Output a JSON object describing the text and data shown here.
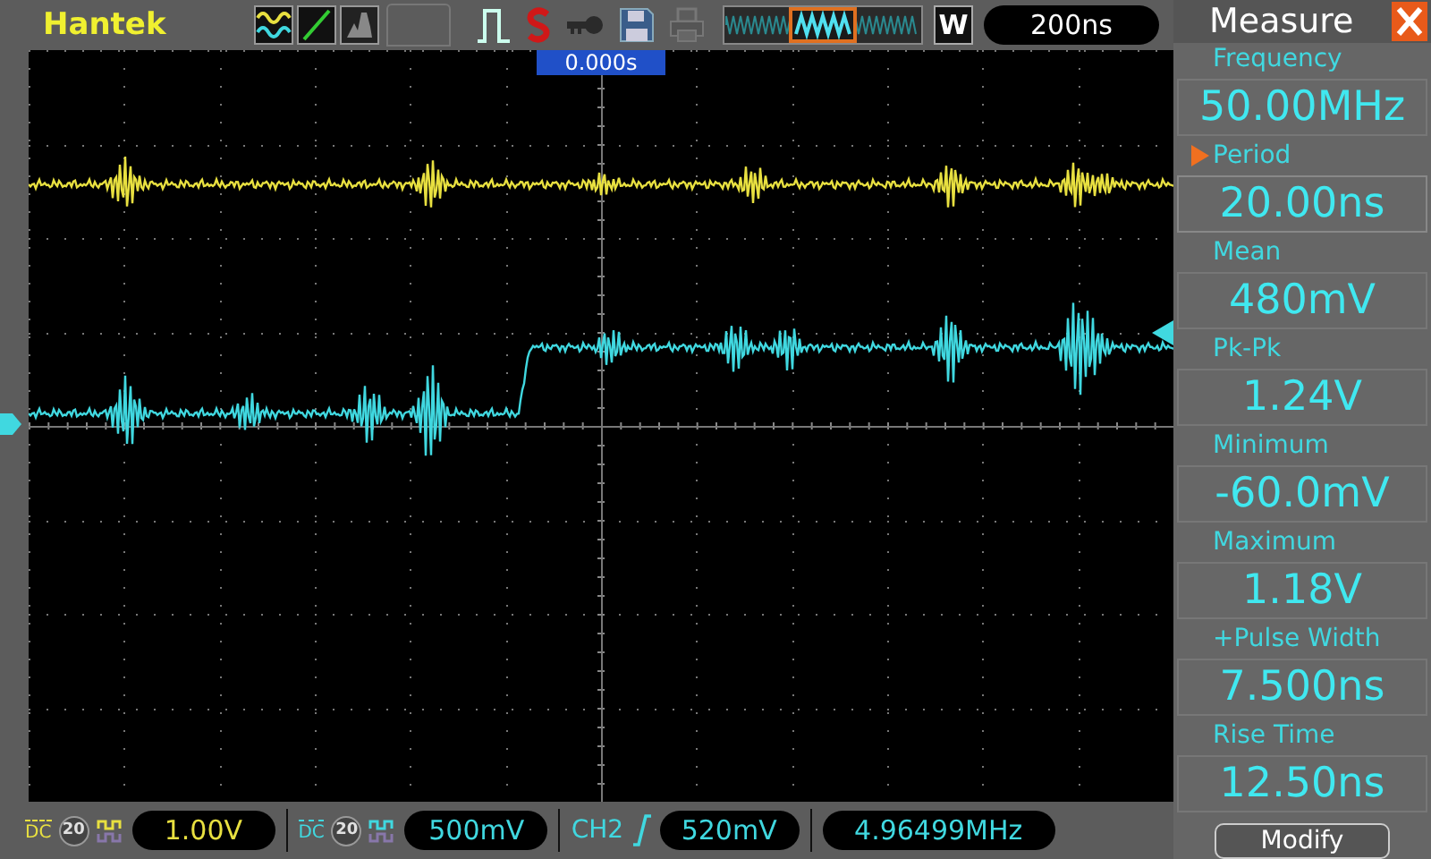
{
  "brand": "Hantek",
  "toolbar": {
    "window_label": "W",
    "timebase": "200ns"
  },
  "trigger_marker": "0.000s",
  "channels": [
    {
      "coupling": "DC",
      "bandwidth_limit": "20",
      "scale": "1.00V",
      "color": "#e8e040"
    },
    {
      "coupling": "DC",
      "bandwidth_limit": "20",
      "scale": "500mV",
      "color": "#40d8e0"
    }
  ],
  "trigger": {
    "source": "CH2",
    "level": "520mV",
    "frequency": "4.96499MHz"
  },
  "measure": {
    "title": "Measure",
    "items": [
      {
        "label": "Frequency",
        "value": "50.00MHz",
        "selected": false
      },
      {
        "label": "Period",
        "value": "20.00ns",
        "selected": true
      },
      {
        "label": "Mean",
        "value": "480mV",
        "selected": false
      },
      {
        "label": "Pk-Pk",
        "value": "1.24V",
        "selected": false
      },
      {
        "label": "Minimum",
        "value": "-60.0mV",
        "selected": false
      },
      {
        "label": "Maximum",
        "value": "1.18V",
        "selected": false
      },
      {
        "label": "+Pulse Width",
        "value": "7.500ns",
        "selected": false
      },
      {
        "label": "Rise Time",
        "value": "12.50ns",
        "selected": false
      }
    ],
    "button": "Modify"
  }
}
